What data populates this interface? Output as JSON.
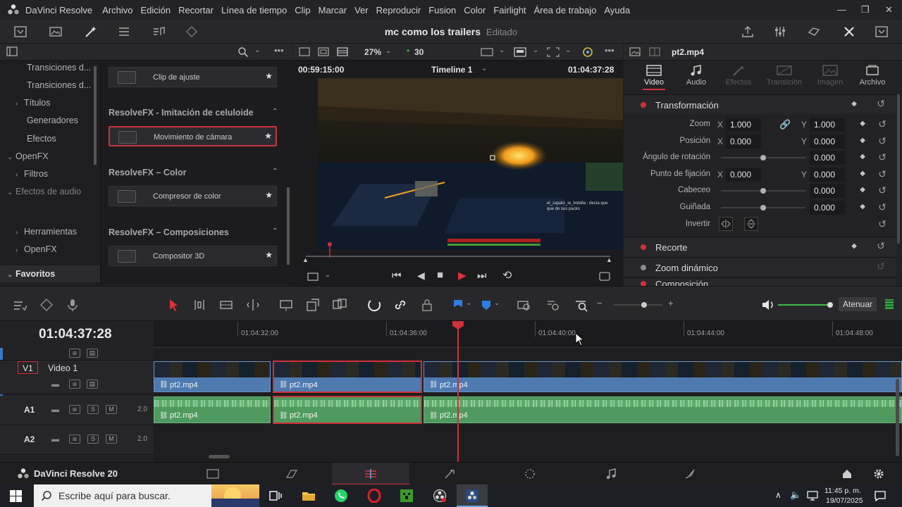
{
  "menubar": {
    "app": "DaVinci Resolve",
    "items": [
      "Archivo",
      "Edición",
      "Recortar",
      "Línea de tiempo",
      "Clip",
      "Marcar",
      "Ver",
      "Reproducir",
      "Fusion",
      "Color",
      "Fairlight",
      "Área de trabajo",
      "Ayuda"
    ]
  },
  "project": {
    "name": "mc como los trailers",
    "status": "Editado"
  },
  "viewer": {
    "zoom": "27%",
    "fps": "30",
    "source_timecode": "00:59:15:00",
    "timeline_name": "Timeline 1",
    "record_timecode": "01:04:37:28",
    "chat_line1": "el_zapato_la_botella : decía que",
    "chat_line2": "que de sus packs"
  },
  "inspector": {
    "clip_name": "pt2.mp4",
    "tabs": [
      "Video",
      "Audio",
      "Efectos",
      "Transición",
      "Imagen",
      "Archivo"
    ],
    "transform_title": "Transformación",
    "zoom": {
      "label": "Zoom",
      "x": "1.000",
      "y": "1.000"
    },
    "position": {
      "label": "Posición",
      "x": "0.000",
      "y": "0.000"
    },
    "rotation": {
      "label": "Ángulo de rotación",
      "value": "0.000"
    },
    "anchor": {
      "label": "Punto de fijación",
      "x": "0.000",
      "y": "0.000"
    },
    "pitch": {
      "label": "Cabeceo",
      "value": "0.000"
    },
    "yaw": {
      "label": "Guiñada",
      "value": "0.000"
    },
    "flip": {
      "label": "Invertir"
    },
    "axis_x": "X",
    "axis_y": "Y",
    "crop_title": "Recorte",
    "dynzoom_title": "Zoom dinámico",
    "composite_title": "Composición"
  },
  "media_tree": {
    "items": [
      "Transiciones d...",
      "Transiciones d...",
      "Títulos",
      "Generadores",
      "Efectos",
      "OpenFX",
      "Filtros",
      "Efectos de audio"
    ],
    "favorites": "Favoritos",
    "fav_items": [
      "Herramientas",
      "OpenFX"
    ]
  },
  "fx_list": {
    "item0": "Clip de ajuste",
    "cat1": "ResolveFX - Imitación de celuloide",
    "item1": "Movimiento de cámara",
    "cat2": "ResolveFX – Color",
    "item2": "Compresor de color",
    "cat3": "ResolveFX – Composiciones",
    "item3": "Compositor 3D"
  },
  "timeline": {
    "timecode": "01:04:37:28",
    "ruler": [
      "01:04:32:00",
      "01:04:36:00",
      "01:04:40:00",
      "01:04:44:00",
      "01:04:48:00"
    ],
    "atenuar": "Atenuar",
    "tracks": {
      "v1_tag": "V1",
      "v1_name": "Video 1",
      "a1_tag": "A1",
      "a2_tag": "A2",
      "a1_vol": "2.0",
      "a2_vol": "2.0",
      "s": "S",
      "m": "M"
    },
    "clip_name": "pt2.mp4"
  },
  "footer": {
    "brand": "DaVinci Resolve 20"
  },
  "taskbar": {
    "search": "Escribe aquí para buscar.",
    "time": "11:45 p. m.",
    "date": "19/07/2025"
  },
  "colors": {
    "accent_red": "#d0303a",
    "video_clip": "#4f7ab0",
    "audio_clip": "#4f9a5e"
  }
}
